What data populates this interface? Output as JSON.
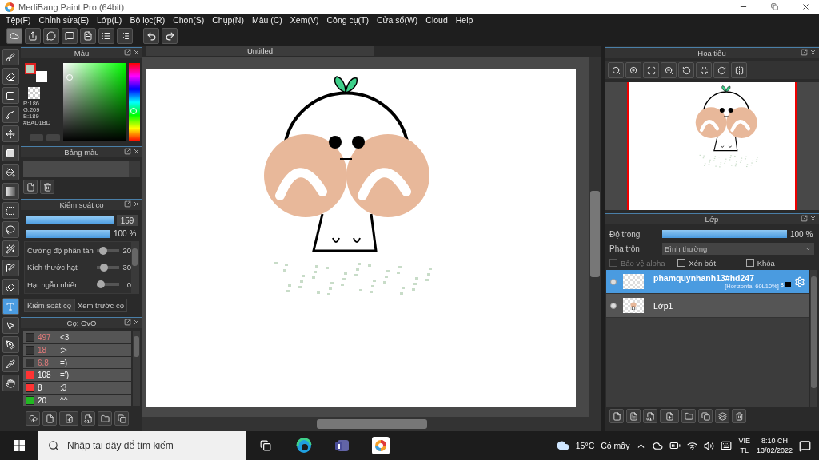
{
  "window": {
    "title": "MediBang Paint Pro (64bit)"
  },
  "menu": [
    "Tệp(F)",
    "Chỉnh sửa(E)",
    "Lớp(L)",
    "Bộ lọc(R)",
    "Chọn(S)",
    "Chụp(N)",
    "Màu (C)",
    "Xem(V)",
    "Công cụ(T)",
    "Cửa sổ(W)",
    "Cloud",
    "Help"
  ],
  "tools": [
    {
      "selected": false
    },
    {
      "selected": false
    },
    {
      "selected": false
    },
    {
      "selected": false
    },
    {
      "selected": false
    },
    {
      "selected": false
    },
    {
      "selected": false
    },
    {
      "selected": false
    },
    {
      "selected": false
    },
    {
      "selected": false
    },
    {
      "selected": false
    },
    {
      "selected": false
    },
    {
      "selected": false
    },
    {
      "selected": true
    },
    {
      "selected": false
    },
    {
      "selected": false
    },
    {
      "selected": false
    },
    {
      "selected": false
    }
  ],
  "document_tab": {
    "title": "Untitled"
  },
  "color_panel": {
    "title": "Màu",
    "color": "#bad1bd",
    "readout": [
      "R:186",
      "G:209",
      "B:189",
      "#BAD1BD"
    ]
  },
  "palette_panel": {
    "title": "Bảng màu",
    "entry": "---"
  },
  "brush_control": {
    "title": "Kiểm soát cọ",
    "size": {
      "level": 1,
      "value": "159"
    },
    "opacity": {
      "level": 1,
      "value": "100 %"
    },
    "params": [
      {
        "label": "Cường độ phân tán",
        "value": "20"
      },
      {
        "label": "Kích thước hạt",
        "value": "30"
      },
      {
        "label": "Hạt ngẫu nhiên",
        "value": "0"
      }
    ],
    "tabs": [
      {
        "label": "Kiểm soát cọ",
        "selected": true
      },
      {
        "label": "Xem trước cọ",
        "selected": false
      }
    ]
  },
  "brush_panel": {
    "title": "Cọ: OvO",
    "brushes": [
      {
        "size": "497",
        "name": "<3",
        "color": "#333333",
        "flagged": true
      },
      {
        "size": "18",
        "name": ":>",
        "color": "#333333",
        "flagged": true
      },
      {
        "size": "6.8",
        "name": "=)",
        "color": "#333333",
        "flagged": true
      },
      {
        "size": "108",
        "name": "=')",
        "color": "#ff3333",
        "flagged": false
      },
      {
        "size": "8",
        "name": ":3",
        "color": "#ff3333",
        "flagged": false
      },
      {
        "size": "20",
        "name": "^^",
        "color": "#22b822",
        "flagged": false
      }
    ]
  },
  "navigator": {
    "title": "Hoa tiêu"
  },
  "layer_panel": {
    "title": "Lớp",
    "opacity": {
      "label": "Độ trong",
      "level": 1,
      "value": "100 %"
    },
    "blend": {
      "label": "Pha trộn",
      "value": "Bình thường"
    },
    "options": [
      {
        "label": "Bảo vệ alpha",
        "checked": false,
        "disabled": true
      },
      {
        "label": "Xén bớt",
        "checked": false,
        "disabled": false
      },
      {
        "label": "Khóa",
        "checked": false,
        "disabled": false
      }
    ],
    "layers": [
      {
        "name": "phamquynhanh13#hd247",
        "detail": "[Horizontal 60L10%]",
        "count": "8",
        "selected": true,
        "visible": true,
        "kind": "halftone"
      },
      {
        "name": "Lớp1",
        "selected": false,
        "visible": true,
        "kind": "normal"
      }
    ]
  },
  "taskbar": {
    "search_placeholder": "Nhập tại đây để tìm kiếm",
    "temperature": "15°C",
    "weather": "Có mây",
    "language": "VIE",
    "layout": "TL",
    "time": "8:10 CH",
    "date": "13/02/2022"
  }
}
